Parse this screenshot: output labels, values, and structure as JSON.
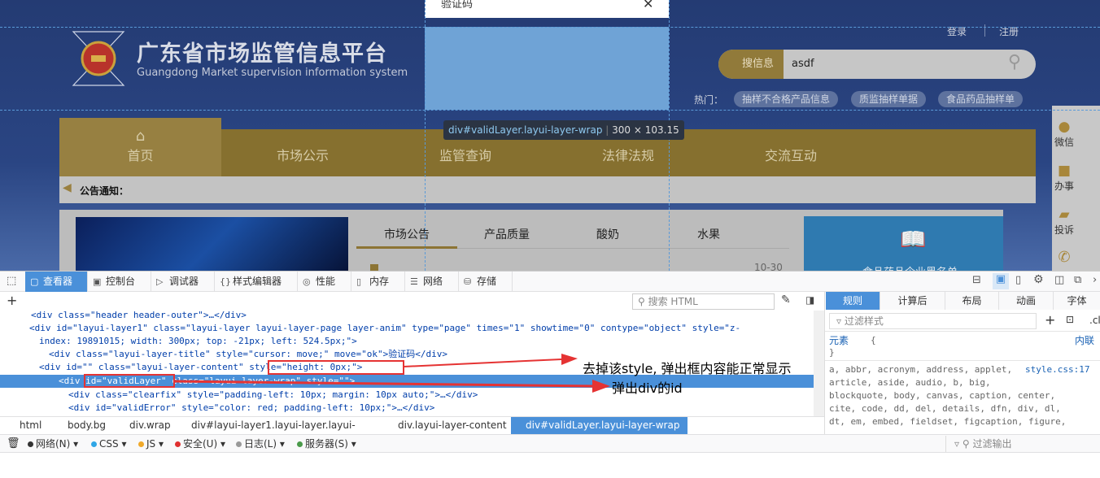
{
  "page": {
    "title_cn": "广东省市场监管信息平台",
    "title_en": "Guangdong Market supervision information system",
    "login": "登录",
    "register": "注册",
    "search_label": "搜信息",
    "search_value": "asdf",
    "hot_label": "热门：",
    "hot_tags": [
      "抽样不合格产品信息",
      "质监抽样单据",
      "食品药品抽样单"
    ],
    "nav": [
      "首页",
      "市场公示",
      "监管查询",
      "法律法规",
      "交流互动"
    ],
    "notice": "公告通知：",
    "tabs": [
      "市场公告",
      "产品质量",
      "酸奶",
      "水果"
    ],
    "date": "10-30",
    "right_box": "食品药品企业黑名单",
    "side": [
      "微信",
      "办事",
      "投诉"
    ],
    "dialog_title": "验证码",
    "tooltip_selector": "div#validLayer.layui-layer-wrap",
    "tooltip_size": "300 × 103.15"
  },
  "devtools": {
    "tabs": [
      "查看器",
      "控制台",
      "调试器",
      "样式编辑器",
      "性能",
      "内存",
      "网络",
      "存储"
    ],
    "search_placeholder": "搜索 HTML",
    "code": [
      "<div class=\"header header-outer\">…</div>",
      "<div id=\"layui-layer1\" class=\"layui-layer layui-layer-page layer-anim\" type=\"page\" times=\"1\" showtime=\"0\" contype=\"object\" style=\"z-",
      "index: 19891015; width: 300px; top: -21px; left: 524.5px;\">",
      "<div class=\"layui-layer-title\" style=\"cursor: move;\" move=\"ok\">验证码</div>",
      "<div id=\"\" class=\"layui-layer-content\" style=\"height: 0px;\">",
      "<div id=\"validLayer\" class=\"layui-layer-wrap\" style=\"\">",
      "<div class=\"clearfix\" style=\"padding-left: 10px; margin: 10px auto;\">…</div>",
      "<div id=\"validError\" style=\"color: red; padding-left: 10px;\">…</div>"
    ],
    "breadcrumb": [
      "html",
      "body.bg",
      "div.wrap",
      "div#layui-layer1.layui-layer.layui-layer...",
      "div.layui-layer-content",
      "div#validLayer.layui-layer-wrap"
    ],
    "rule_tabs": [
      "规则",
      "计算后",
      "布局",
      "动画",
      "字体"
    ],
    "filter_styles": "过滤样式",
    "cls": ".cls",
    "element_rule": "元素",
    "inline": "内联",
    "open_brace": "{",
    "close_brace": "}",
    "rule_source": "style.css:17",
    "rule_selectors": [
      "a, abbr, acronym, address, applet,",
      "article, aside, audio, b, big,",
      "blockquote, body, canvas, caption, center,",
      "cite, code, dd, del, details, dfn, div, dl,",
      "dt, em, embed, fieldset, figcaption, figure,"
    ],
    "console_filters": [
      {
        "label": "网络(N)",
        "color": "#333333"
      },
      {
        "label": "CSS",
        "color": "#2fa6e6"
      },
      {
        "label": "JS",
        "color": "#f0a92a"
      },
      {
        "label": "安全(U)",
        "color": "#e03030"
      },
      {
        "label": "日志(L)",
        "color": "#999999"
      },
      {
        "label": "服务器(S)",
        "color": "#4a9a4a"
      }
    ],
    "filter_output": "过滤输出"
  },
  "annotations": {
    "style_note": "去掉该style, 弹出框内容能正常显示",
    "id_note": "弹出div的id",
    "color": "#e53333"
  }
}
